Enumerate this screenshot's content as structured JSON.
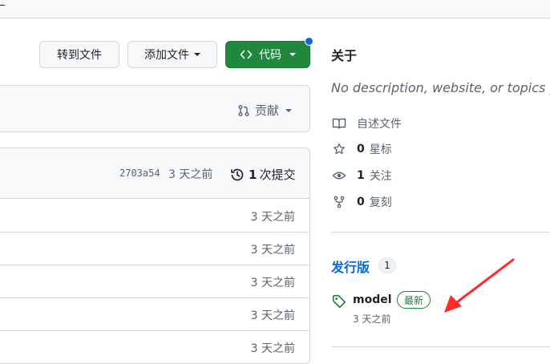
{
  "toolbar": {
    "goto_file": "转到文件",
    "add_file": "添加文件",
    "code": "代码"
  },
  "branch_bar": {
    "contribute": "贡献"
  },
  "commit_bar": {
    "sha": "2703a54",
    "time": "3 天之前",
    "commit_count": "1",
    "commit_label": "次提交"
  },
  "files": [
    {
      "time": "3 天之前"
    },
    {
      "time": "3 天之前"
    },
    {
      "time": "3 天之前"
    },
    {
      "time": "3 天之前"
    },
    {
      "time": "3 天之前"
    }
  ],
  "about": {
    "title": "关于",
    "description": "No description, website, or topics pr",
    "readme": "自述文件",
    "stars_count": "0",
    "stars_label": "星标",
    "watchers_count": "1",
    "watchers_label": "关注",
    "forks_count": "0",
    "forks_label": "复刻"
  },
  "releases": {
    "title": "发行版",
    "count": "1",
    "tag": "model",
    "badge": "最新",
    "date": "3 天之前"
  },
  "colors": {
    "accent": "#0969da",
    "green": "#1f883d",
    "annotation_arrow": "#ff2a2a"
  },
  "icons": [
    "code-icon",
    "pull-request-icon",
    "history-icon",
    "book-icon",
    "star-icon",
    "eye-icon",
    "fork-icon",
    "tag-icon"
  ]
}
